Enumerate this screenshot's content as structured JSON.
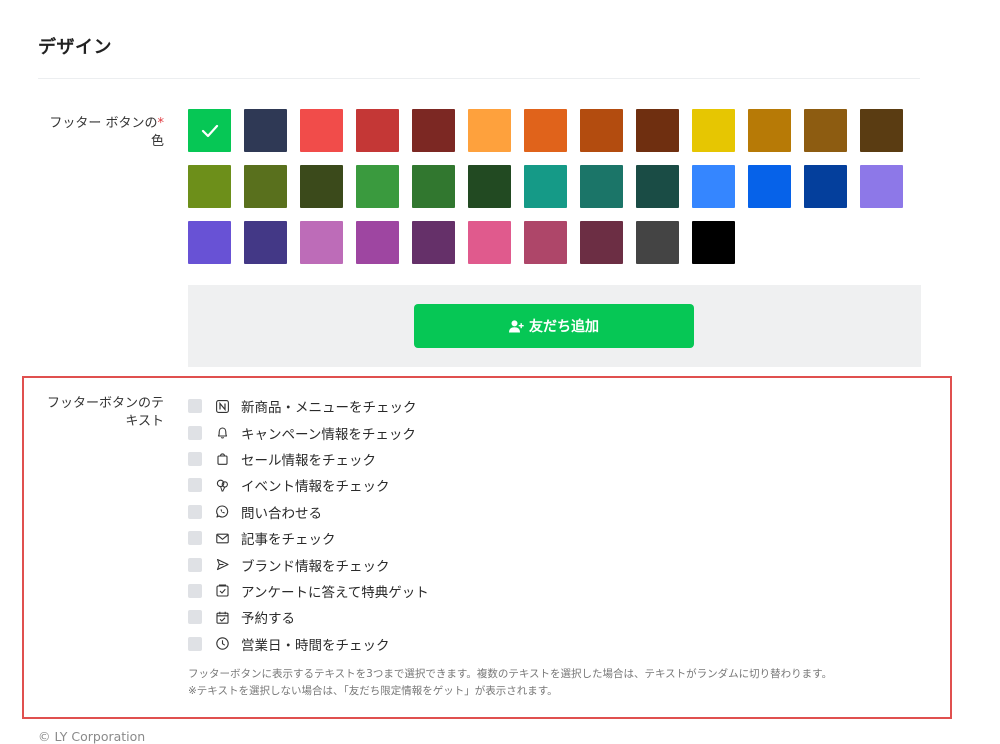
{
  "section": {
    "title": "デザイン"
  },
  "color_row": {
    "label": "フッター ボタンの",
    "label_tail": "色",
    "required_mark": "*",
    "selected_index": 0,
    "swatches": [
      "#06c755",
      "#2f3955",
      "#f14c4a",
      "#c43736",
      "#7c2823",
      "#fea13d",
      "#e0631b",
      "#b34c0f",
      "#6f2f10",
      "#e6c602",
      "#b77a06",
      "#8d5c11",
      "#5a3c12",
      "#6d8f1a",
      "#59701d",
      "#3b4a1b",
      "#3a9a3e",
      "#31772f",
      "#224a22",
      "#159a87",
      "#1b7568",
      "#1a4c45",
      "#3586ff",
      "#0662e9",
      "#043f9c",
      "#8d78e8",
      "#6852d5",
      "#433886",
      "#bd6cb8",
      "#9e46a1",
      "#653069",
      "#e05a8d",
      "#ae4669",
      "#6c2e44",
      "#444444",
      "#000000"
    ]
  },
  "preview": {
    "button_label": "友だち追加",
    "button_color": "#06c755"
  },
  "text_row": {
    "label": "フッターボタンのテ",
    "label_tail": "キスト",
    "options": [
      {
        "icon": "news-icon",
        "label": "新商品・メニューをチェック"
      },
      {
        "icon": "bell-icon",
        "label": "キャンペーン情報をチェック"
      },
      {
        "icon": "shopping-bag-icon",
        "label": "セール情報をチェック"
      },
      {
        "icon": "balloon-icon",
        "label": "イベント情報をチェック"
      },
      {
        "icon": "phone-chat-icon",
        "label": "問い合わせる"
      },
      {
        "icon": "mail-icon",
        "label": "記事をチェック"
      },
      {
        "icon": "send-icon",
        "label": "ブランド情報をチェック"
      },
      {
        "icon": "survey-icon",
        "label": "アンケートに答えて特典ゲット"
      },
      {
        "icon": "calendar-check-icon",
        "label": "予約する"
      },
      {
        "icon": "clock-icon",
        "label": "営業日・時間をチェック"
      }
    ],
    "help_line1": "フッターボタンに表示するテキストを3つまで選択できます。複数のテキストを選択した場合は、テキストがランダムに切り替わります。",
    "help_line2": "※テキストを選択しない場合は、「友だち限定情報をゲット」が表示されます。"
  },
  "footer": {
    "copyright": "© LY Corporation"
  }
}
